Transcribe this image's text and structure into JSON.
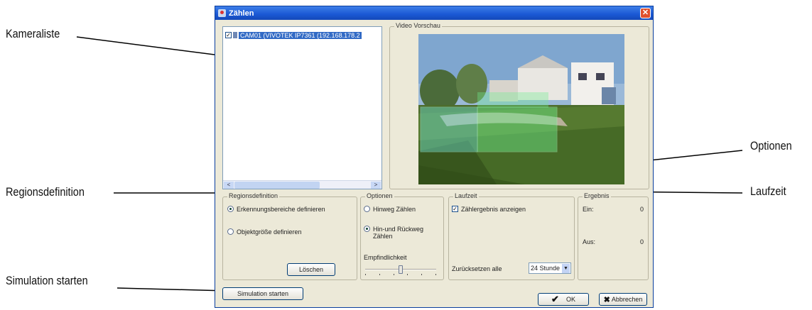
{
  "callouts": {
    "kameraliste": "Kameraliste",
    "regionsdefinition": "Regionsdefinition",
    "simulation": "Simulation starten",
    "optionen": "Optionen",
    "laufzeit": "Laufzeit"
  },
  "window": {
    "title": "Zählen",
    "close_glyph": "✕"
  },
  "camera_list": {
    "items": [
      {
        "label": "CAM01 (VIVOTEK IP7361 (192.168.178.2",
        "checked": true
      }
    ],
    "scroll_left": "<",
    "scroll_right": ">"
  },
  "video": {
    "group_label": "Video Vorschau"
  },
  "regions": {
    "group_label": "Regionsdefinition",
    "option1": "Erkennungsbereiche definieren",
    "option2": "Objektgröße definieren",
    "delete_button": "Löschen"
  },
  "options": {
    "group_label": "Optionen",
    "option1": "Hinweg Zählen",
    "option2": "Hin-und Rückweg Zählen",
    "sensitivity_label": "Empfindlichkeit",
    "sensitivity_level": 0.5
  },
  "runtime": {
    "group_label": "Laufzeit",
    "show_result_label": "Zählergebnis anzeigen",
    "show_result_checked": true,
    "reset_label": "Zurücksetzen alle",
    "reset_value": "24 Stunde"
  },
  "result": {
    "group_label": "Ergebnis",
    "in_label": "Ein:",
    "in_value": "0",
    "out_label": "Aus:",
    "out_value": "0"
  },
  "buttons": {
    "simulation": "Simulation starten",
    "ok": "OK",
    "cancel": "Abbrechen"
  }
}
